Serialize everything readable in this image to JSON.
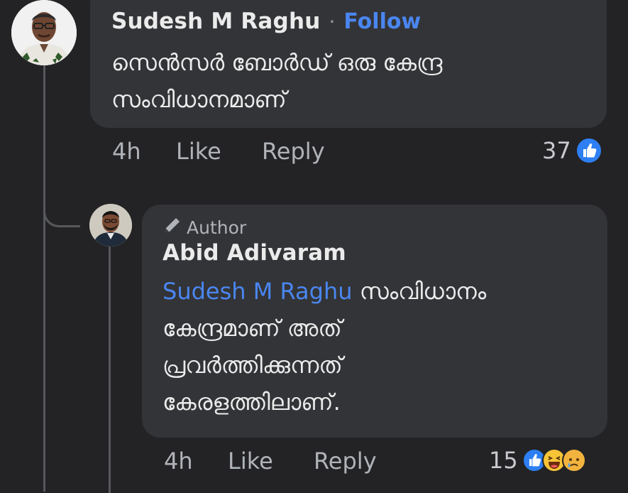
{
  "comment1": {
    "author": "Sudesh M Raghu",
    "separator": "·",
    "follow_label": "Follow",
    "text_line1": "സെൻസർ ബോർഡ് ഒരു കേന്ദ്ര",
    "text_line2": "സംവിധാനമാണ്",
    "time": "4h",
    "like_label": "Like",
    "reply_label": "Reply",
    "reaction_count": "37"
  },
  "comment2": {
    "badge_label": "Author",
    "author": "Abid Adivaram",
    "mention": "Sudesh M Raghu",
    "text_line1_rest": " സംവിധാനം",
    "text_line2": "കേന്ദ്രമാണ് അത്",
    "text_line3": "പ്രവർത്തിക്കുന്നത്",
    "text_line4": "കേരളത്തിലാണ്.",
    "time": "4h",
    "like_label": "Like",
    "reply_label": "Reply",
    "reaction_count": "15"
  },
  "colors": {
    "background": "#232325",
    "bubble": "#333437",
    "link": "#4a86f0",
    "like_blue": "#2d7ff3"
  },
  "icons": [
    "pencil-icon",
    "like-reaction-icon",
    "haha-reaction-icon",
    "sad-reaction-icon"
  ]
}
